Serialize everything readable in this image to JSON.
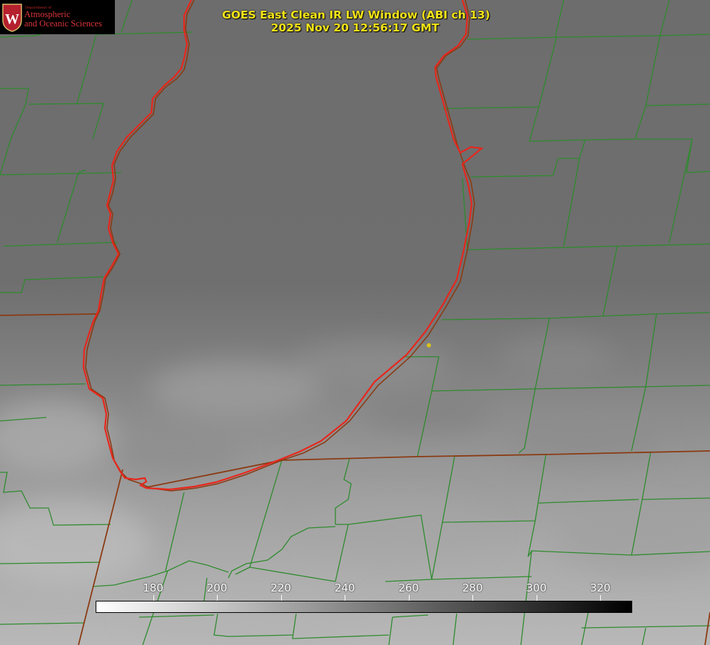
{
  "header": {
    "title_line1": "GOES East Clean IR LW Window (ABI ch 13)",
    "title_line2": "2025 Nov 20 12:56:17 GMT"
  },
  "logo": {
    "department": "Department of",
    "line1": "Atmospheric",
    "line2": "and Oceanic Sciences",
    "crest_letter": "W",
    "crest_color": "#b5202e"
  },
  "colorbar": {
    "ticks": [
      "180",
      "200",
      "220",
      "240",
      "260",
      "280",
      "300",
      "320"
    ],
    "min_value": 162,
    "max_value": 330,
    "start_color": "#ffffff",
    "end_color": "#000000"
  },
  "map": {
    "county_line_color": "#2e8b2e",
    "state_line_color": "#8b3a12",
    "lake_outline_color": "#e8261c",
    "marker_color": "#d8c21a"
  }
}
